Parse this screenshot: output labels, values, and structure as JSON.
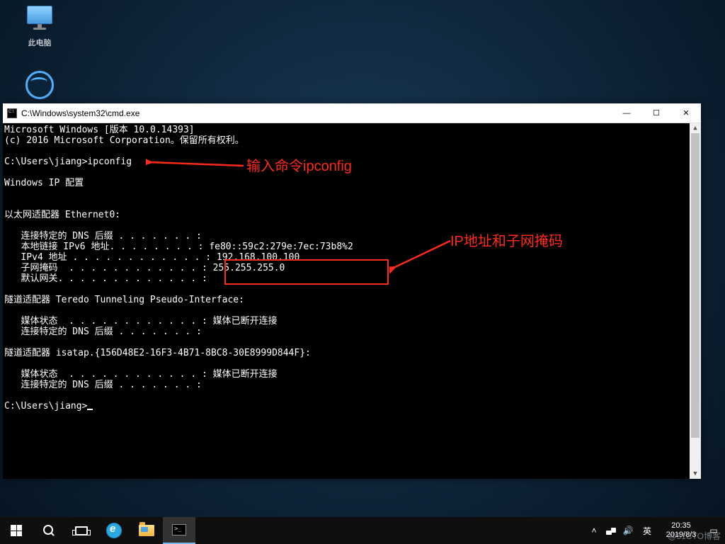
{
  "desktop": {
    "this_pc_label": "此电脑"
  },
  "cmd": {
    "title": "C:\\Windows\\system32\\cmd.exe",
    "header1": "Microsoft Windows [版本 10.0.14393]",
    "header2": "(c) 2016 Microsoft Corporation。保留所有权利。",
    "prompt1_left": "C:\\Users\\jiang>",
    "prompt1_cmd": "ipconfig",
    "ipcfg_title": "Windows IP 配置",
    "adapter0": "以太网适配器 Ethernet0:",
    "l_dns_suffix": "   连接特定的 DNS 后缀 . . . . . . . :",
    "l_ipv6": "   本地链接 IPv6 地址. . . . . . . . : fe80::59c2:279e:7ec:73b8%2",
    "l_ipv4_label": "   IPv4 地址 . . . . . . . . . . . . : ",
    "l_ipv4_val": "192.168.100.100",
    "l_mask_label": "   子网掩码  . . . . . . . . . . . . : ",
    "l_mask_val": "255.255.255.0",
    "l_gateway": "   默认网关. . . . . . . . . . . . . :",
    "adapter1": "隧道适配器 Teredo Tunneling Pseudo-Interface:",
    "l_media": "   媒体状态  . . . . . . . . . . . . : 媒体已断开连接",
    "adapter2": "隧道适配器 isatap.{156D48E2-16F3-4B71-8BC8-30E8999D844F}:",
    "prompt2": "C:\\Users\\jiang>"
  },
  "annotations": {
    "cmd_label": "输入命令ipconfig",
    "ip_label": "IP地址和子网掩码"
  },
  "taskbar": {
    "ime": "英",
    "time": "20:35",
    "date": "2019/8/3"
  },
  "watermark": "@51CTO博客"
}
